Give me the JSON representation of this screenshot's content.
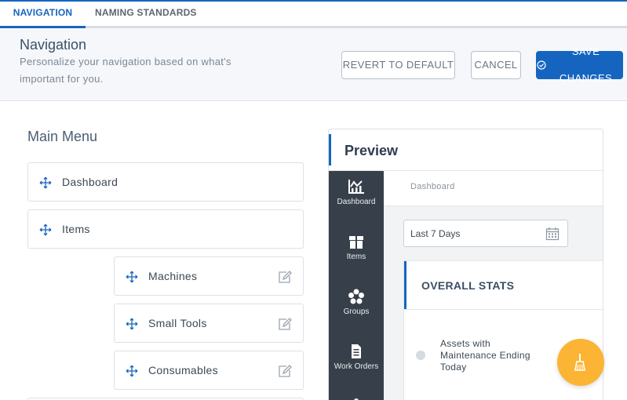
{
  "tabs": [
    {
      "label": "NAVIGATION",
      "active": true
    },
    {
      "label": "NAMING STANDARDS",
      "active": false
    }
  ],
  "header": {
    "title": "Navigation",
    "description": "Personalize your navigation based on what's important for you.",
    "revert_label": "REVERT TO DEFAULT",
    "cancel_label": "CANCEL",
    "save_label": "SAVE CHANGES"
  },
  "main_menu": {
    "title": "Main Menu",
    "items": [
      {
        "label": "Dashboard",
        "icon": "move-icon"
      },
      {
        "label": "Items",
        "icon": "move-icon"
      },
      {
        "label": "Machines",
        "icon": "move-icon",
        "editable": true,
        "sub": true
      },
      {
        "label": "Small Tools",
        "icon": "move-icon",
        "editable": true,
        "sub": true
      },
      {
        "label": "Consumables",
        "icon": "move-icon",
        "editable": true,
        "sub": true
      }
    ]
  },
  "preview": {
    "title": "Preview",
    "nav": [
      {
        "label": "Dashboard",
        "icon": "dashboard-chart-icon"
      },
      {
        "label": "Items",
        "icon": "gift-box-icon"
      },
      {
        "label": "Groups",
        "icon": "flower-icon"
      },
      {
        "label": "Work Orders",
        "icon": "document-icon"
      }
    ],
    "breadcrumb": "Dashboard",
    "date_range": "Last 7 Days",
    "stats_title": "OVERALL STATS",
    "stat_label": "Assets with Maintenance Ending Today"
  },
  "colors": {
    "accent": "#1565c0",
    "sidebar": "#37404a",
    "fab": "#fbb433"
  },
  "fab_icon": "broom-icon"
}
